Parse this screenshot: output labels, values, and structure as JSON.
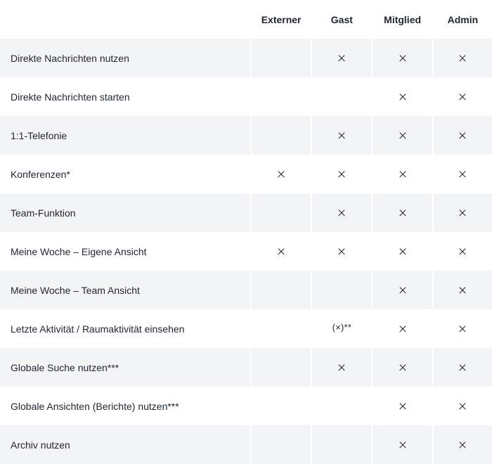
{
  "header": {
    "columns": [
      "Externer",
      "Gast",
      "Mitglied",
      "Admin"
    ]
  },
  "mark_symbol": "x-mark",
  "partial_mark_text": "(×)**",
  "rows": [
    {
      "label": "Direkte Nachrichten nutzen",
      "cells": [
        "",
        "x",
        "x",
        "x"
      ]
    },
    {
      "label": "Direkte Nachrichten starten",
      "cells": [
        "",
        "",
        "x",
        "x"
      ]
    },
    {
      "label": "1:1-Telefonie",
      "cells": [
        "",
        "x",
        "x",
        "x"
      ]
    },
    {
      "label": "Konferenzen*",
      "cells": [
        "x",
        "x",
        "x",
        "x"
      ]
    },
    {
      "label": "Team-Funktion",
      "cells": [
        "",
        "x",
        "x",
        "x"
      ]
    },
    {
      "label": "Meine Woche – Eigene Ansicht",
      "cells": [
        "x",
        "x",
        "x",
        "x"
      ]
    },
    {
      "label": "Meine Woche – Team Ansicht",
      "cells": [
        "",
        "",
        "x",
        "x"
      ]
    },
    {
      "label": "Letzte Aktivität / Raumaktivität einsehen",
      "cells": [
        "",
        "(×)**",
        "x",
        "x"
      ]
    },
    {
      "label": "Globale Suche nutzen***",
      "cells": [
        "",
        "x",
        "x",
        "x"
      ]
    },
    {
      "label": "Globale Ansichten (Berichte) nutzen***",
      "cells": [
        "",
        "",
        "x",
        "x"
      ]
    },
    {
      "label": "Archiv nutzen",
      "cells": [
        "",
        "",
        "x",
        "x"
      ]
    }
  ],
  "colors": {
    "shaded_row": "#f3f4f6",
    "text": "#1f2530",
    "background": "#ffffff"
  }
}
